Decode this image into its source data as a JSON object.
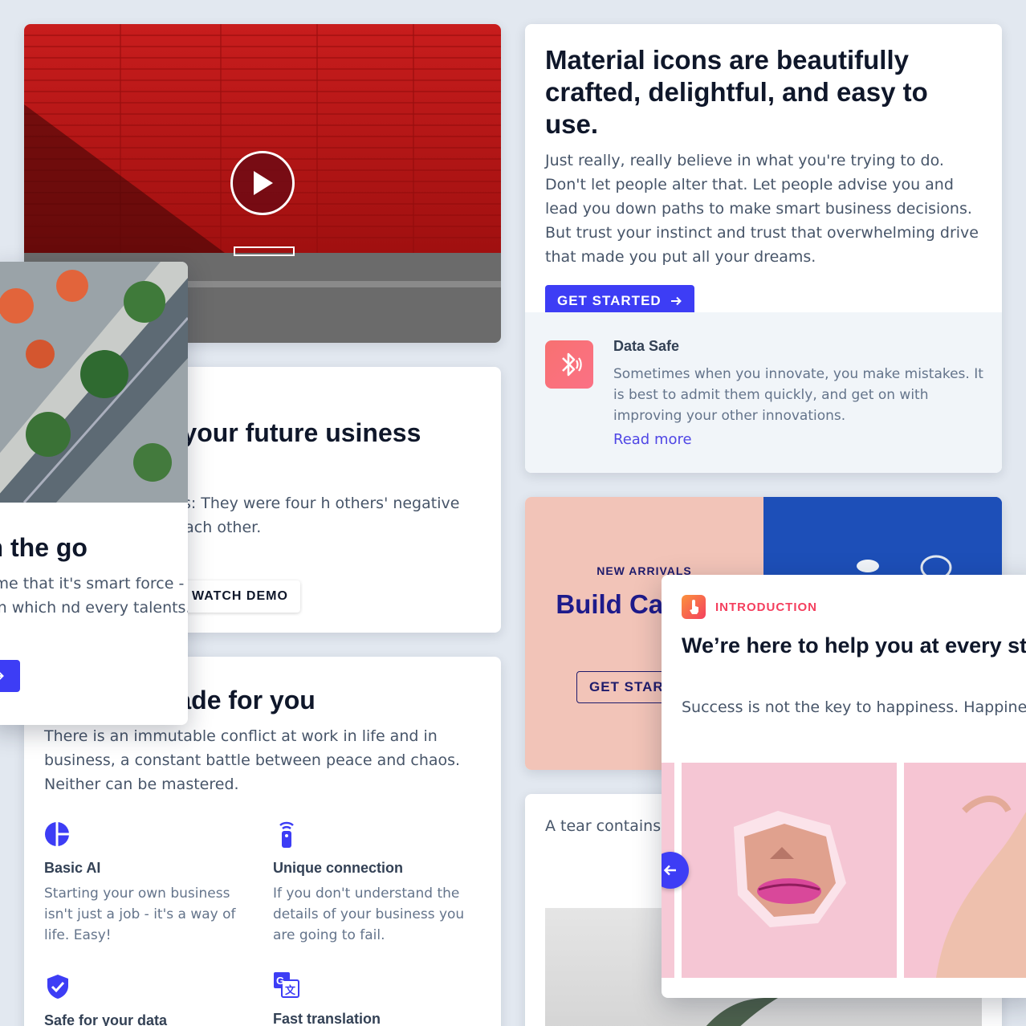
{
  "video_card": {
    "play_icon": "play-icon"
  },
  "material_card": {
    "title": "Material icons are beautifully crafted, delightful, and easy to use.",
    "description": "Just really, really believe in what you're trying to do. Don't let people alter that. Let people advise you and lead you down paths to make smart business decisions. But trust your instinct and trust that overwhelming drive that made you put all your dreams.",
    "button_label": "GET STARTED",
    "feature": {
      "icon": "bluetooth-icon",
      "title": "Data Safe",
      "description": "Sometimes when you innovate, you make mistakes. It is best to admit them quickly, and get on with improving your other innovations.",
      "link": "Read more"
    }
  },
  "growing_card": {
    "title": "to growing your future usiness",
    "description": "ness is The Beatles: They were four h others' negative tendencies in ed each other.",
    "button_label": "WATCH DEMO"
  },
  "platform_card": {
    "title": "platform made for you",
    "description": "There is an immutable conflict at work in life and in business, a constant battle between peace and chaos. Neither can be mastered.",
    "features": [
      {
        "icon": "pie-chart-icon",
        "title": "Basic AI",
        "description": "Starting your own business isn't just a job - it's a way of life. Easy!"
      },
      {
        "icon": "remote-icon",
        "title": "Unique connection",
        "description": "If you don't understand the details of your business you are going to fail."
      },
      {
        "icon": "shield-check-icon",
        "title": "Safe for your data",
        "description": ""
      },
      {
        "icon": "translate-icon",
        "title": "Fast translation",
        "description": ""
      }
    ]
  },
  "go_card": {
    "title": "on the go",
    "description": "he time that it's smart force - one in which nd every talents."
  },
  "arrivals_card": {
    "tag": "NEW ARRIVALS",
    "title": "Build Car Big Sp",
    "button_label": "GET START"
  },
  "tear_card": {
    "description": "A tear contains tiny moments i If you see som"
  },
  "intro_card": {
    "icon": "touch-icon",
    "tag": "INTRODUCTION",
    "title": "We’re here to help you at every stage amazing journey.",
    "description": "Success is not the key to happiness. Happine key to success. If you love what you are doing"
  }
}
